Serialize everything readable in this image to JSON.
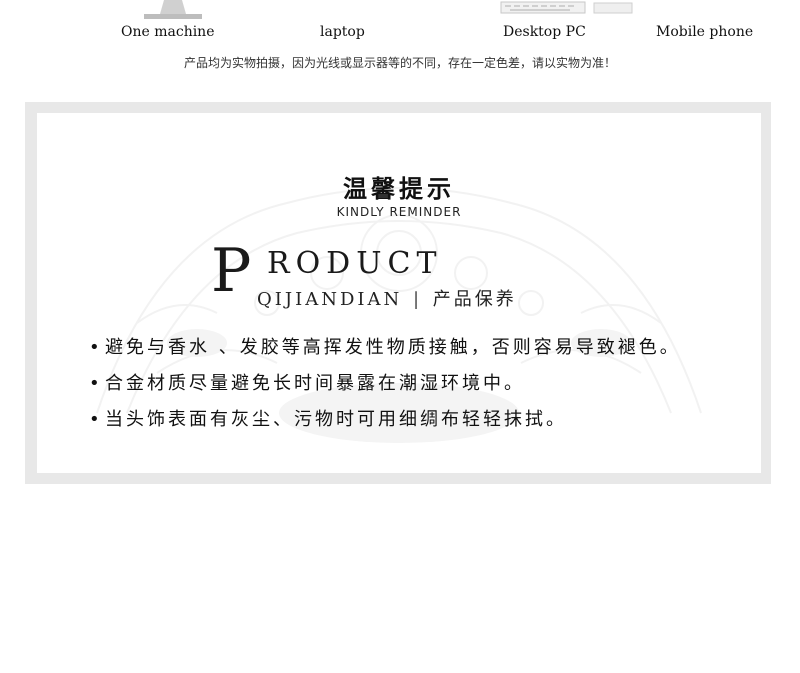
{
  "devices": [
    {
      "label": "One machine"
    },
    {
      "label": "laptop"
    },
    {
      "label": "Desktop PC"
    },
    {
      "label": "Mobile phone"
    }
  ],
  "disclaimer": "产品均为实物拍摄，因为光线或显示器等的不同，存在一定色差，请以实物为准！",
  "reminder": {
    "title_cn": "温馨提示",
    "title_en": "KINDLY REMINDER",
    "product_p": "P",
    "product_rest": "RODUCT",
    "brand": "QIJIANDIAN",
    "brand_sep": "|",
    "brand_cn": "产品保养",
    "bullet": "•",
    "tips": [
      "避免与香水 、发胶等高挥发性物质接触，否则容易导致褪色。",
      "合金材质尽量避免长时间暴露在潮湿环境中。",
      "当头饰表面有灰尘、污物时可用细绸布轻轻抹拭。"
    ]
  }
}
